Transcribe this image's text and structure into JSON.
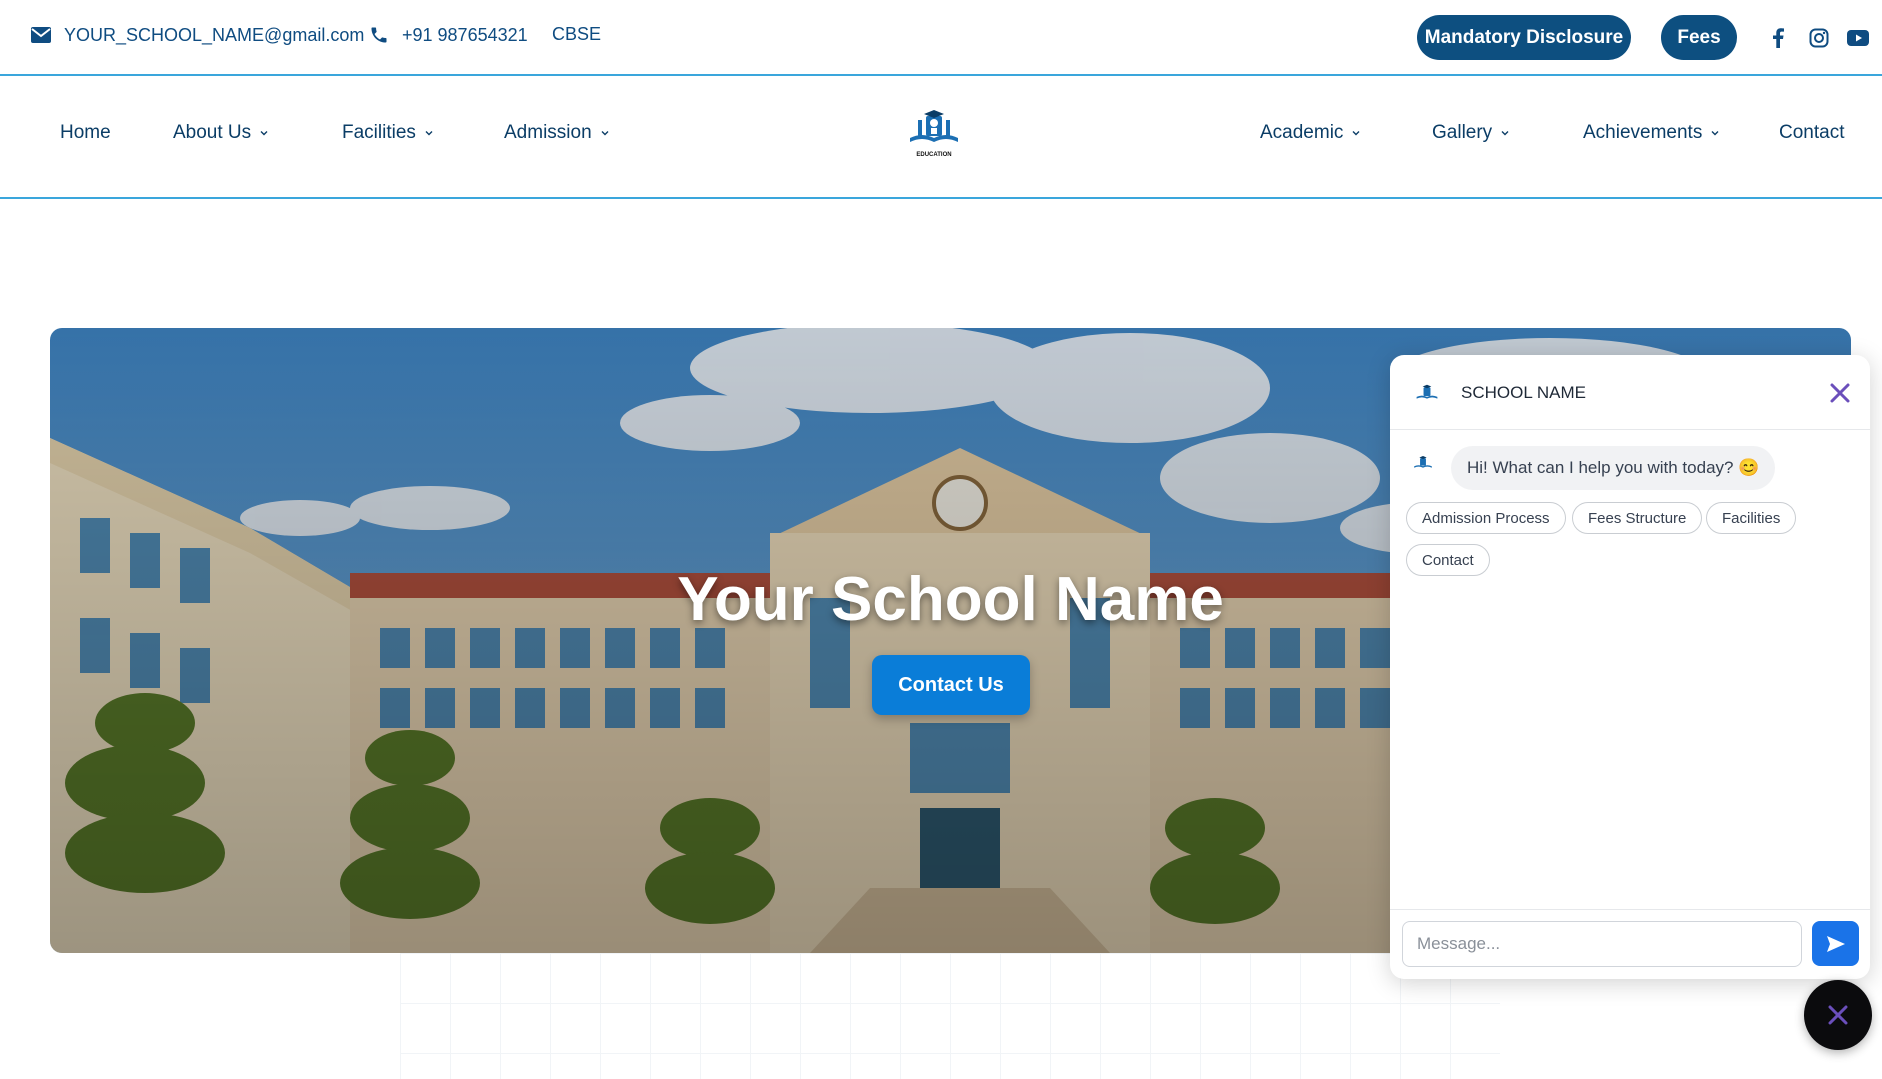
{
  "topbar": {
    "email": "YOUR_SCHOOL_NAME@gmail.com",
    "phone": "+91 987654321",
    "board": "CBSE",
    "mandatory_disclosure_label": "Mandatory Disclosure",
    "fees_label": "Fees",
    "social_icons": [
      "facebook-icon",
      "instagram-icon",
      "youtube-icon"
    ]
  },
  "nav": {
    "left": [
      {
        "label": "Home",
        "has_dropdown": false
      },
      {
        "label": "About Us",
        "has_dropdown": true
      },
      {
        "label": "Facilities",
        "has_dropdown": true
      },
      {
        "label": "Admission",
        "has_dropdown": true
      }
    ],
    "right": [
      {
        "label": "Academic",
        "has_dropdown": true
      },
      {
        "label": "Gallery",
        "has_dropdown": true
      },
      {
        "label": "Achievements",
        "has_dropdown": true
      },
      {
        "label": "Contact",
        "has_dropdown": false
      }
    ],
    "logo_caption": "EDUCATION"
  },
  "hero": {
    "title": "Your School Name",
    "button_label": "Contact Us"
  },
  "chat": {
    "header_title": "SCHOOL NAME",
    "bot_message": "Hi! What can I help you with today? 😊",
    "quick_replies": [
      "Admission Process",
      "Fees Structure",
      "Facilities",
      "Contact"
    ],
    "input_placeholder": "Message..."
  },
  "colors": {
    "primary_dark": "#0d4f80",
    "accent_line": "#3aa6dc",
    "hero_button": "#0a7dd8",
    "send_button": "#1a73e8",
    "close_icon": "#6b4fbb"
  }
}
